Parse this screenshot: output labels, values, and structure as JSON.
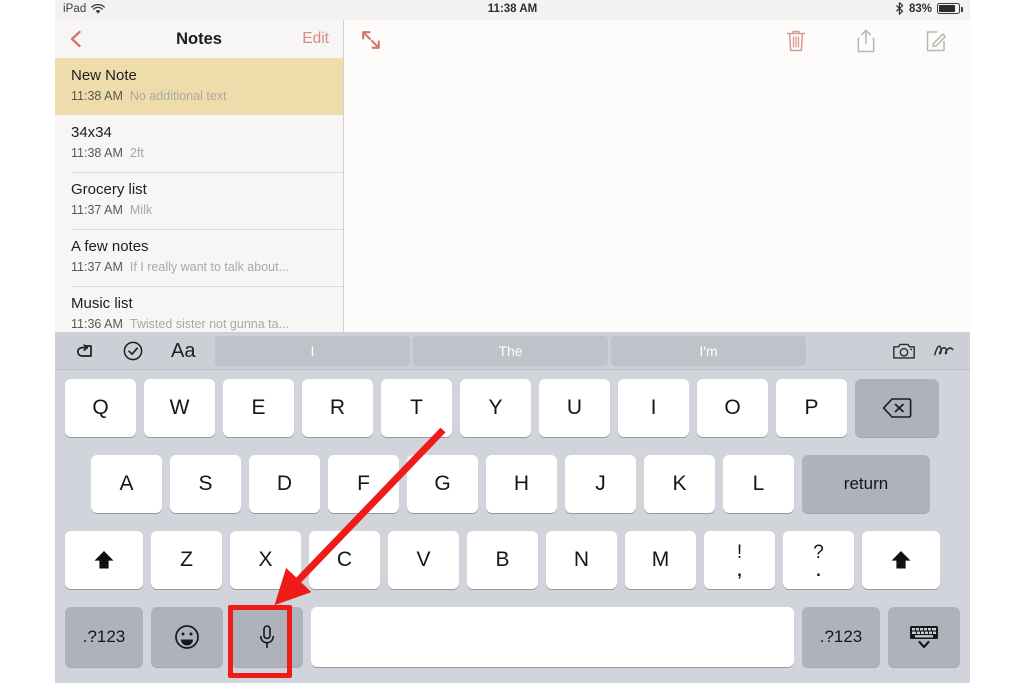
{
  "status_bar": {
    "device_label": "iPad",
    "wifi_icon": "wifi-icon",
    "time": "11:38 AM",
    "bluetooth_icon": "bluetooth-icon",
    "battery_percent": "83%",
    "battery_icon": "battery-icon"
  },
  "notes_list": {
    "back_icon": "back-chevron-icon",
    "title": "Notes",
    "edit_label": "Edit",
    "items": [
      {
        "title": "New Note",
        "time": "11:38 AM",
        "snippet": "No additional text",
        "selected": true
      },
      {
        "title": "34x34",
        "time": "11:38 AM",
        "snippet": "2ft",
        "selected": false
      },
      {
        "title": "Grocery list",
        "time": "11:37 AM",
        "snippet": "Milk",
        "selected": false
      },
      {
        "title": "A few notes",
        "time": "11:37 AM",
        "snippet": "If I really want to talk about...",
        "selected": false
      },
      {
        "title": "Music list",
        "time": "11:36 AM",
        "snippet": "Twisted sister not gunna ta...",
        "selected": false
      }
    ]
  },
  "detail_pane": {
    "expand_icon": "expand-arrows-icon",
    "actions": [
      {
        "name": "delete-note-button",
        "icon": "trash-icon"
      },
      {
        "name": "share-note-button",
        "icon": "share-icon"
      },
      {
        "name": "compose-note-button",
        "icon": "compose-icon"
      }
    ],
    "body_text": ""
  },
  "keyboard": {
    "toolbar": {
      "undo_icon": "undo-icon",
      "checklist_icon": "checklist-circle-icon",
      "format_label": "Aa",
      "camera_icon": "camera-icon",
      "markup_icon": "handwriting-squiggle-icon"
    },
    "predictions": [
      "I",
      "The",
      "I'm"
    ],
    "row1": [
      "Q",
      "W",
      "E",
      "R",
      "T",
      "Y",
      "U",
      "I",
      "O",
      "P"
    ],
    "row1_end": {
      "name": "backspace-key",
      "icon": "backspace-icon"
    },
    "row2": [
      "A",
      "S",
      "D",
      "F",
      "G",
      "H",
      "J",
      "K",
      "L"
    ],
    "row2_end": {
      "label": "return"
    },
    "row3_shift_icon": "shift-arrow-icon",
    "row3": [
      "Z",
      "X",
      "C",
      "V",
      "B",
      "N",
      "M"
    ],
    "row3_dual": [
      {
        "top": "!",
        "bottom": ","
      },
      {
        "top": "?",
        "bottom": "."
      }
    ],
    "row4": {
      "numbers_left": ".?123",
      "emoji_icon": "emoji-smiley-icon",
      "mic_icon": "microphone-icon",
      "space_label": "",
      "numbers_right": ".?123",
      "hide_icon": "hide-keyboard-icon"
    }
  },
  "annotation": {
    "highlight_color": "#ee1b19",
    "highlight_target": "microphone-key",
    "arrow": "pointer-arrow-to-microphone-key"
  }
}
